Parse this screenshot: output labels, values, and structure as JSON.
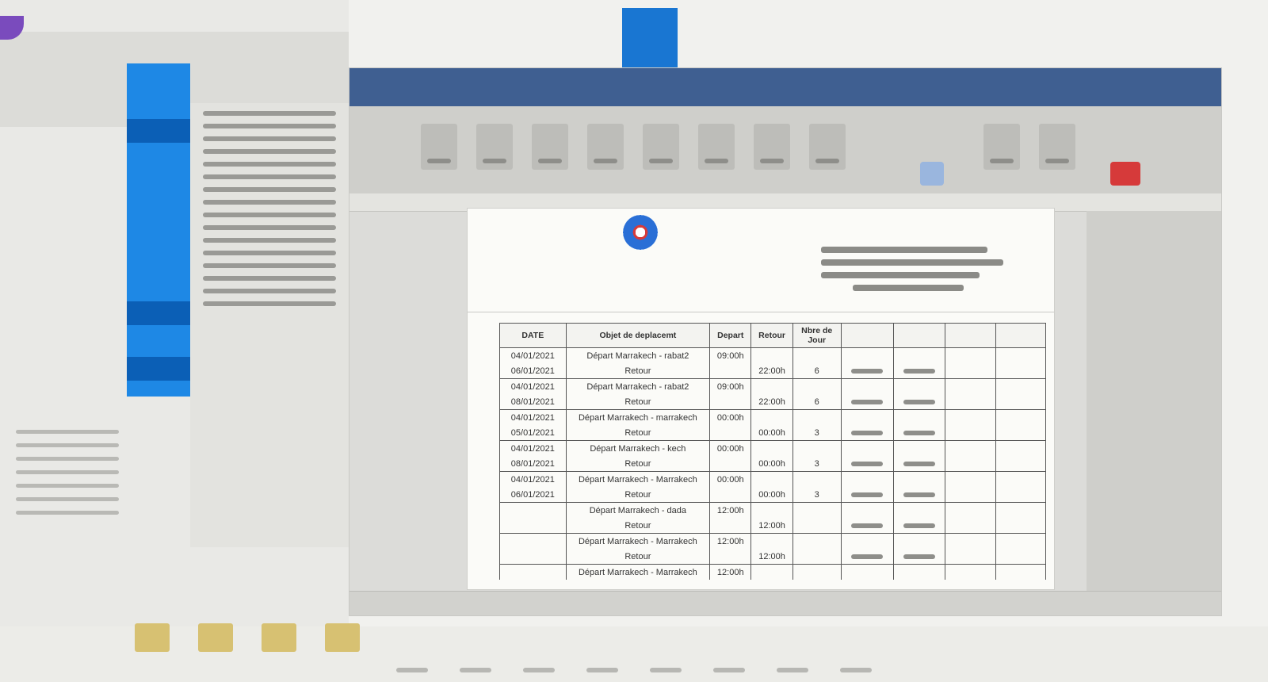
{
  "window": {
    "title": ""
  },
  "document": {
    "org_header": "",
    "table": {
      "headers": [
        "DATE",
        "Objet de deplacemt",
        "Depart",
        "Retour",
        "Nbre de Jour",
        "",
        "",
        "",
        ""
      ],
      "rows": [
        {
          "out": {
            "date": "04/01/2021",
            "object": "Départ Marrakech - rabat2",
            "time": "09:00h"
          },
          "back": {
            "date": "06/01/2021",
            "object": "Retour",
            "time": "22:00h",
            "days": "6"
          }
        },
        {
          "out": {
            "date": "04/01/2021",
            "object": "Départ Marrakech - rabat2",
            "time": "09:00h"
          },
          "back": {
            "date": "08/01/2021",
            "object": "Retour",
            "time": "22:00h",
            "days": "6"
          }
        },
        {
          "out": {
            "date": "04/01/2021",
            "object": "Départ Marrakech - marrakech",
            "time": "00:00h"
          },
          "back": {
            "date": "05/01/2021",
            "object": "Retour",
            "time": "00:00h",
            "days": "3"
          }
        },
        {
          "out": {
            "date": "04/01/2021",
            "object": "Départ Marrakech - kech",
            "time": "00:00h"
          },
          "back": {
            "date": "08/01/2021",
            "object": "Retour",
            "time": "00:00h",
            "days": "3"
          }
        },
        {
          "out": {
            "date": "04/01/2021",
            "object": "Départ Marrakech - Marrakech",
            "time": "00:00h"
          },
          "back": {
            "date": "06/01/2021",
            "object": "Retour",
            "time": "00:00h",
            "days": "3"
          }
        },
        {
          "out": {
            "date": "",
            "object": "Départ Marrakech - dada",
            "time": "12:00h"
          },
          "back": {
            "date": "",
            "object": "Retour",
            "time": "12:00h",
            "days": ""
          }
        },
        {
          "out": {
            "date": "",
            "object": "Départ Marrakech - Marrakech",
            "time": "12:00h"
          },
          "back": {
            "date": "",
            "object": "Retour",
            "time": "12:00h",
            "days": ""
          }
        },
        {
          "out": {
            "date": "",
            "object": "Départ Marrakech - Marrakech",
            "time": "12:00h"
          },
          "back": {
            "date": "",
            "object": "",
            "time": "",
            "days": ""
          }
        }
      ]
    }
  },
  "colors": {
    "titlebar": "#3f5f91",
    "accent": "#1e88e5",
    "table_border": "#555555"
  },
  "icons": [
    "emblem-icon",
    "red-toolbar-icon",
    "blue-toolbar-icon"
  ]
}
